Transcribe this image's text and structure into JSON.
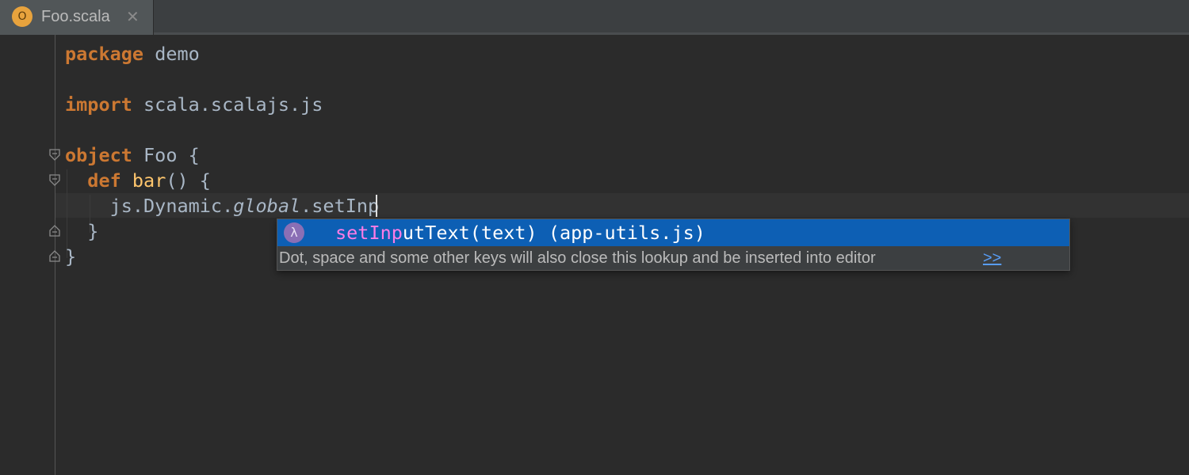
{
  "tab": {
    "icon_letter": "O",
    "filename": "Foo.scala",
    "close_glyph": "✕",
    "icon_name": "scala-object-file-icon"
  },
  "editor": {
    "lines": [
      {
        "tokens": [
          {
            "t": "package",
            "c": "kw"
          },
          {
            "t": " demo",
            "c": ""
          }
        ]
      },
      {
        "tokens": []
      },
      {
        "tokens": [
          {
            "t": "import",
            "c": "kw"
          },
          {
            "t": " scala.scalajs.js",
            "c": ""
          }
        ]
      },
      {
        "tokens": []
      },
      {
        "tokens": [
          {
            "t": "object",
            "c": "kw"
          },
          {
            "t": " Foo {",
            "c": ""
          }
        ]
      },
      {
        "tokens": [
          {
            "t": "  ",
            "c": ""
          },
          {
            "t": "def",
            "c": "kw"
          },
          {
            "t": " ",
            "c": ""
          },
          {
            "t": "bar",
            "c": "fn"
          },
          {
            "t": "() {",
            "c": ""
          }
        ]
      },
      {
        "tokens": [
          {
            "t": "    js.Dynamic.",
            "c": ""
          },
          {
            "t": "global",
            "c": "it"
          },
          {
            "t": ".setInp",
            "c": ""
          }
        ]
      },
      {
        "tokens": [
          {
            "t": "  }",
            "c": ""
          }
        ]
      },
      {
        "tokens": [
          {
            "t": "}",
            "c": ""
          }
        ]
      }
    ]
  },
  "completion": {
    "icon_glyph": "λ",
    "icon_name": "lambda-icon",
    "match_prefix": "setInp",
    "rest_text": "utText(text) (app-utils.js)",
    "hint": "Dot, space and some other keys will also close this lookup and be inserted into editor",
    "more_link": ">>"
  },
  "colors": {
    "background": "#2b2b2b",
    "keyword": "#cc7832",
    "function": "#ffc66d",
    "text": "#a9b7c6",
    "selection": "#0d5fb4",
    "match": "#ff7ce6",
    "link": "#589df6"
  }
}
